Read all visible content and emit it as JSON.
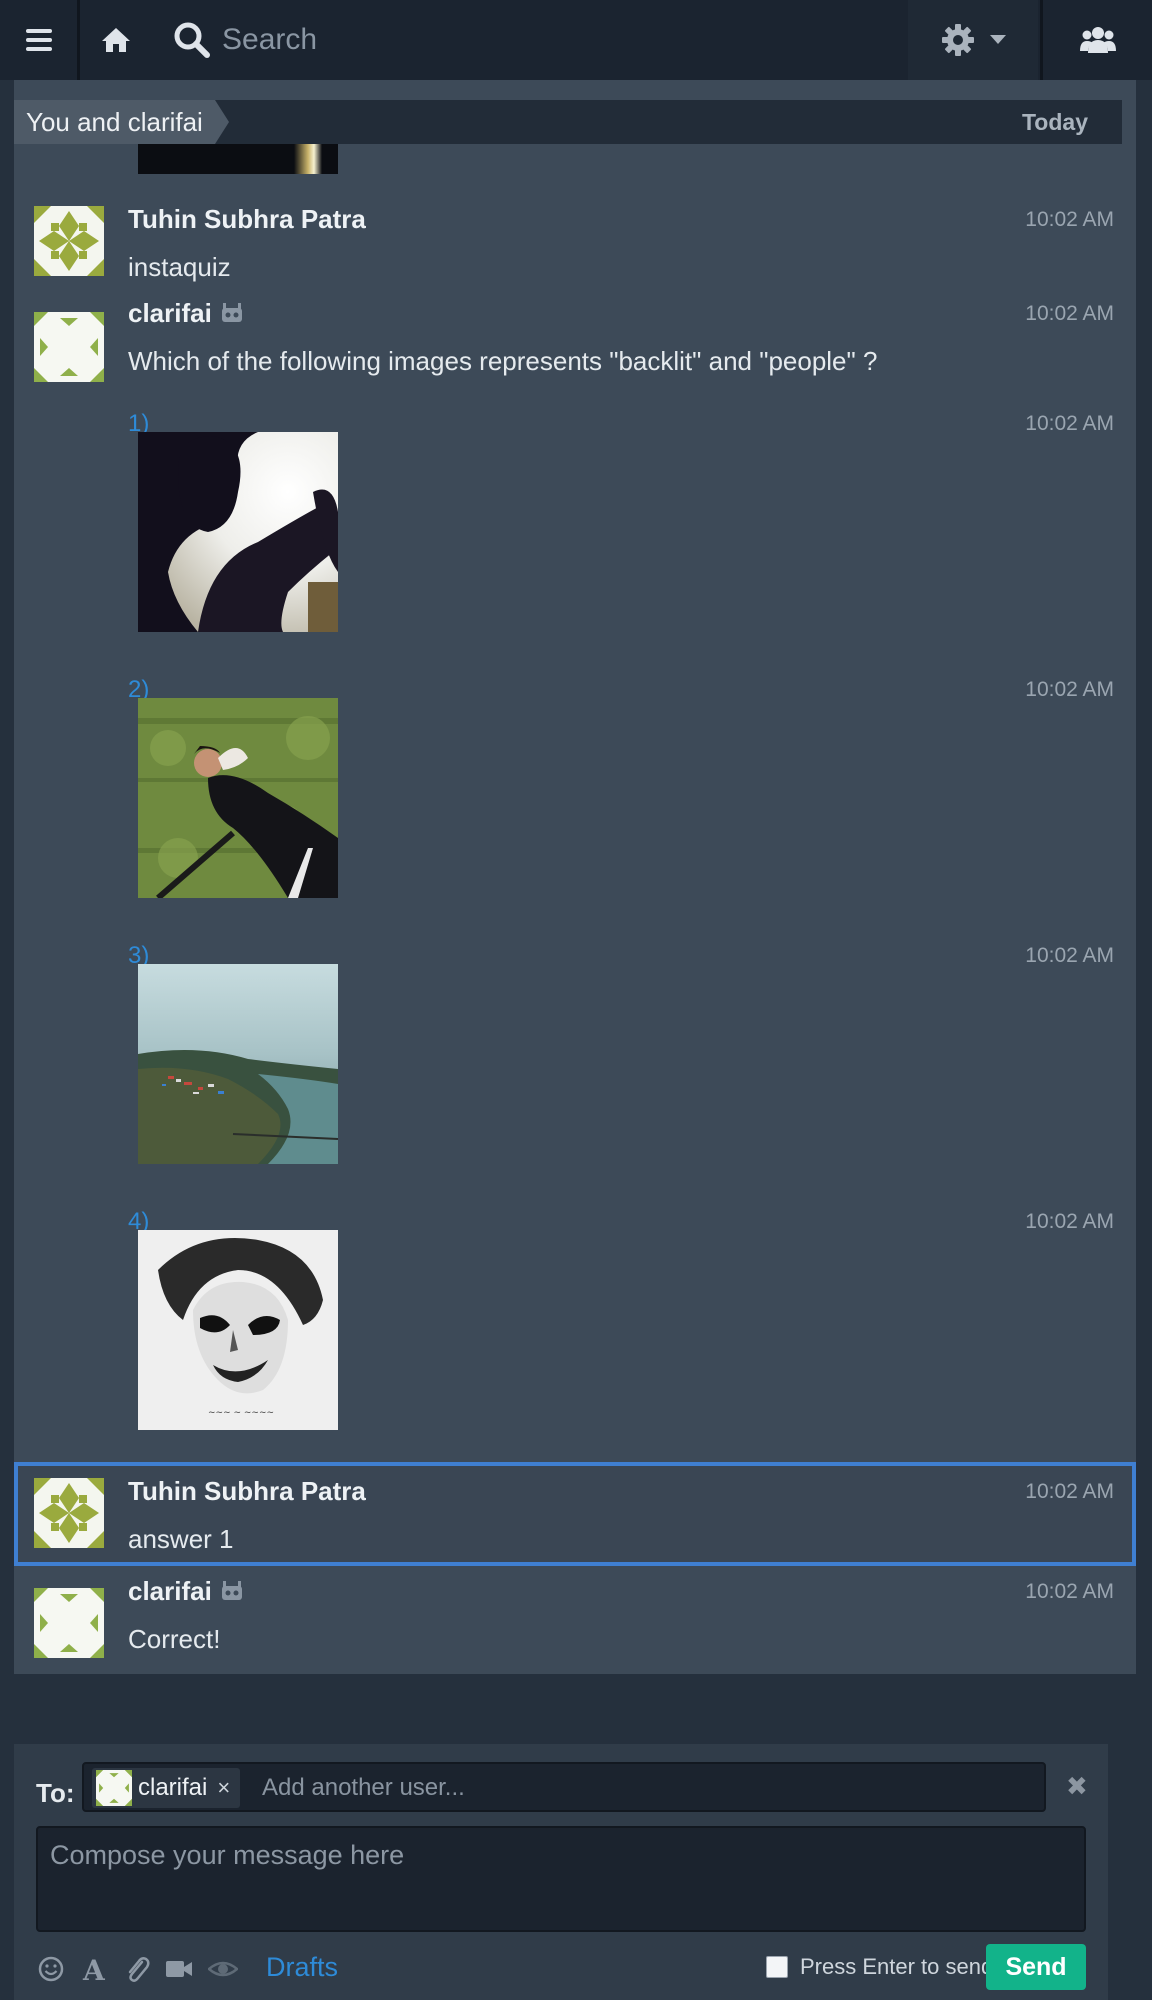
{
  "topbar": {
    "search_placeholder": "Search",
    "icons": [
      "menu-icon",
      "home-icon",
      "search-icon",
      "gear-icon",
      "chevron-down-icon",
      "users-icon"
    ]
  },
  "conversation": {
    "title": "You and clarifai",
    "date": "Today"
  },
  "messages": [
    {
      "sender": "Tuhin Subhra Patra",
      "text": "instaquiz",
      "time": "10:02 AM"
    },
    {
      "sender": "clarifai",
      "bot": true,
      "text": "Which of the following images represents \"backlit\" and \"people\" ?",
      "time": "10:02 AM"
    },
    {
      "label": "1)",
      "time": "10:02 AM",
      "image": "backlit silhouette photo"
    },
    {
      "label": "2)",
      "time": "10:02 AM",
      "image": "man lying on grass photo"
    },
    {
      "label": "3)",
      "time": "10:02 AM",
      "image": "aerial river landscape photo"
    },
    {
      "label": "4)",
      "time": "10:02 AM",
      "image": "joker face sketch"
    },
    {
      "sender": "Tuhin Subhra Patra",
      "text": "answer 1",
      "time": "10:02 AM"
    },
    {
      "sender": "clarifai",
      "bot": true,
      "text": "Correct!",
      "time": "10:02 AM"
    }
  ],
  "compose": {
    "to_label": "To:",
    "recipient": "clarifai",
    "recipient_remove": "×",
    "add_user_placeholder": "Add another user...",
    "message_placeholder": "Compose your message here",
    "drafts_label": "Drafts",
    "enter_to_send_label": "Press Enter to send",
    "send_label": "Send",
    "close": "✖"
  },
  "colors": {
    "accent_link": "#2e8bd8",
    "send_button": "#12b38a",
    "selected_border": "#3f7fd1"
  }
}
